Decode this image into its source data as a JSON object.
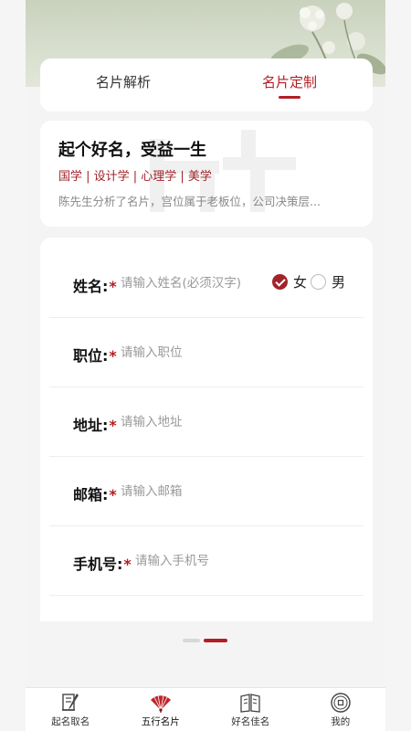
{
  "tabs": [
    {
      "label": "名片解析",
      "active": false
    },
    {
      "label": "名片定制",
      "active": true
    }
  ],
  "intro": {
    "title": "起个好名，受益一生",
    "tags": "国学 | 设计学 | 心理学 | 美学",
    "description": "陈先生分析了名片，宫位属于老板位，公司决策层..."
  },
  "form": {
    "name": {
      "label": "姓名:",
      "required": "*",
      "placeholder": "请输入姓名(必须汉字)"
    },
    "gender": {
      "options": [
        "女",
        "男"
      ],
      "selected": "女"
    },
    "position": {
      "label": "职位:",
      "required": "*",
      "placeholder": "请输入职位"
    },
    "address": {
      "label": "地址:",
      "required": "*",
      "placeholder": "请输入地址"
    },
    "email": {
      "label": "邮箱:",
      "required": "*",
      "placeholder": "请输入邮箱"
    },
    "phone": {
      "label": "手机号:",
      "required": "*",
      "placeholder": "请输入手机号"
    }
  },
  "pager": {
    "pages": 2,
    "current": 2
  },
  "bottom_nav": [
    {
      "label": "起名取名",
      "icon": "scroll-brush-icon"
    },
    {
      "label": "五行名片",
      "icon": "fan-icon",
      "active": true
    },
    {
      "label": "好名佳名",
      "icon": "book-icon"
    },
    {
      "label": "我的",
      "icon": "coin-icon"
    }
  ],
  "colors": {
    "accent": "#b21e24",
    "background": "#f4f4f4"
  }
}
